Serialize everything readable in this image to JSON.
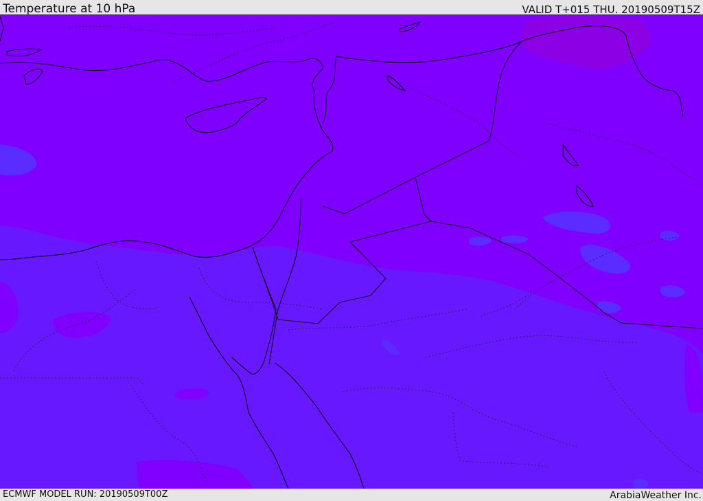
{
  "header": {
    "title": "Temperature at 10 hPa",
    "valid": "VALID T+015 THU. 20190509T15Z"
  },
  "footer": {
    "model_run": "ECMWF MODEL RUN: 20190509T00Z",
    "credit": "ArabiaWeather Inc."
  },
  "map": {
    "field": "temperature",
    "level": "10 hPa",
    "colors": {
      "warm_violet": "#7f00ff",
      "cool_indigo": "#6718ff",
      "cold_blue": "#5a2cff",
      "warmest_magenta": "#8e00e0",
      "coastline": "#000000",
      "border": "#222222"
    }
  }
}
